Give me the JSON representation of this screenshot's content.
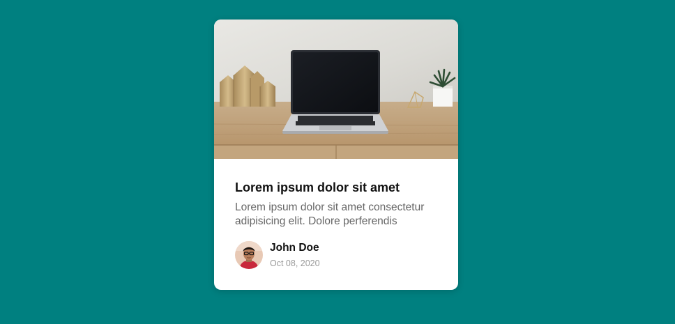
{
  "colors": {
    "background": "#008080",
    "card": "#ffffff",
    "title": "#111111",
    "text": "#666666",
    "date": "#999999"
  },
  "card": {
    "image_icon": "laptop-on-desk-photo",
    "title": "Lorem ipsum dolor sit amet",
    "description": "Lorem ipsum dolor sit amet consectetur adipisicing elit. Dolore perferendis",
    "author": {
      "avatar_icon": "user-avatar-photo",
      "name": "John Doe",
      "date": "Oct 08, 2020"
    }
  }
}
